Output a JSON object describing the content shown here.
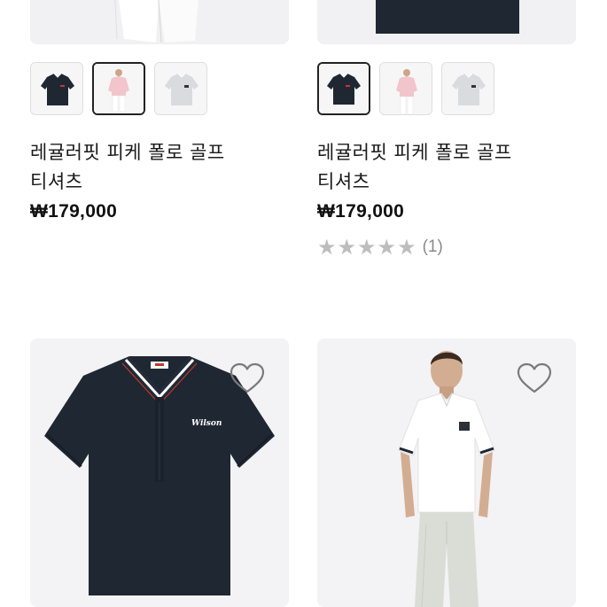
{
  "products": [
    {
      "name_line1": "레귤러핏 피케 폴로 골프",
      "name_line2": "티셔츠",
      "price": "₩179,000",
      "selected_swatch": 2
    },
    {
      "name_line1": "레귤러핏 피케 폴로 골프",
      "name_line2": "티셔츠",
      "price": "₩179,000",
      "selected_swatch": 1,
      "rating_count": "(1)",
      "stars": 5,
      "rating_value": 0
    },
    {
      "wishlist_icon": "heart-outline-icon",
      "logo_text": "Wilson"
    },
    {
      "wishlist_icon": "heart-outline-icon"
    }
  ],
  "colors": {
    "navy": "#1f2733",
    "pink": "#f2c4cc",
    "light_gray": "#d9dadd",
    "star_empty": "#bdbdbd",
    "image_bg": "#f3f2f4"
  }
}
